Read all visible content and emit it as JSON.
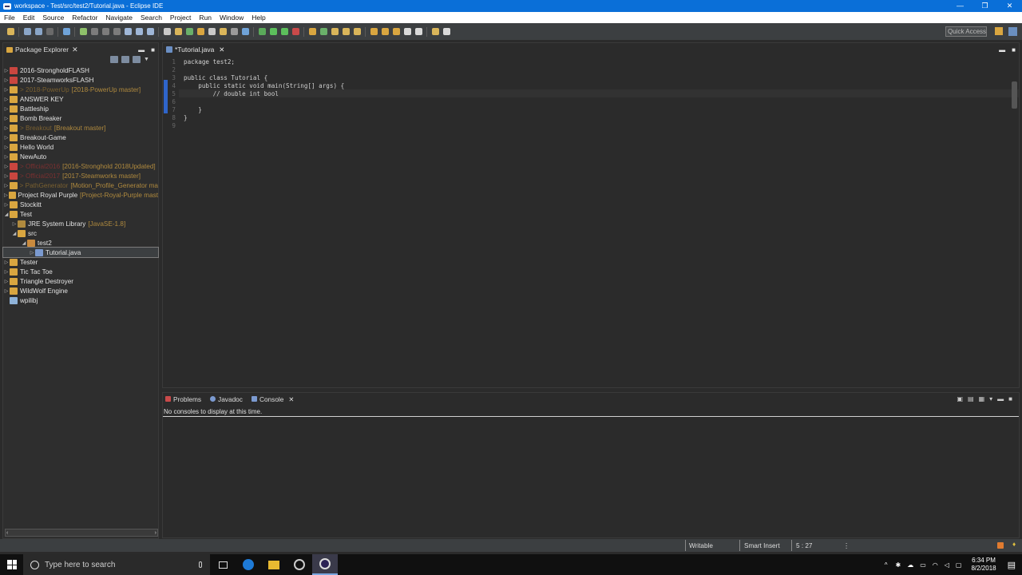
{
  "window": {
    "title": "workspace - Test/src/test2/Tutorial.java - Eclipse IDE",
    "minimize": "—",
    "maximize": "❐",
    "close": "✕"
  },
  "menu": [
    "File",
    "Edit",
    "Source",
    "Refactor",
    "Navigate",
    "Search",
    "Project",
    "Run",
    "Window",
    "Help"
  ],
  "toolbar": {
    "quick_access": "Quick Access"
  },
  "package_explorer": {
    "title": "Package Explorer",
    "items": [
      {
        "label": "2016-StrongholdFLASH",
        "deco": ""
      },
      {
        "label": "2017-SteamworksFLASH",
        "deco": ""
      },
      {
        "label": "> 2018-PowerUp",
        "deco": "[2018-PowerUp master]"
      },
      {
        "label": "ANSWER KEY",
        "deco": ""
      },
      {
        "label": "Battleship",
        "deco": ""
      },
      {
        "label": "Bomb Breaker",
        "deco": ""
      },
      {
        "label": "> Breakout",
        "deco": "[Breakout master]"
      },
      {
        "label": "Breakout-Game",
        "deco": ""
      },
      {
        "label": "Hello World",
        "deco": ""
      },
      {
        "label": "NewAuto",
        "deco": ""
      },
      {
        "label": "> Official2016",
        "deco": "[2016-Stronghold 2018Updated]"
      },
      {
        "label": "> Official2017",
        "deco": "[2017-Steamworks master]"
      },
      {
        "label": "> PathGenerator",
        "deco": "[Motion_Profile_Generator ma"
      },
      {
        "label": "Project Royal Purple",
        "deco": "[Project-Royal-Purple mast"
      },
      {
        "label": "Stockitt",
        "deco": ""
      },
      {
        "label": "Test",
        "deco": ""
      },
      {
        "label": "JRE System Library",
        "deco": "[JavaSE-1.8]"
      },
      {
        "label": "src",
        "deco": ""
      },
      {
        "label": "test2",
        "deco": ""
      },
      {
        "label": "Tutorial.java",
        "deco": ""
      },
      {
        "label": "Tester",
        "deco": ""
      },
      {
        "label": "Tic Tac Toe",
        "deco": ""
      },
      {
        "label": "Triangle Destroyer",
        "deco": ""
      },
      {
        "label": "WildWolf Engine",
        "deco": ""
      },
      {
        "label": "wpilibj",
        "deco": ""
      }
    ]
  },
  "editor": {
    "tab_label": "*Tutorial.java",
    "lines": [
      {
        "n": "1",
        "text": "package test2;"
      },
      {
        "n": "2",
        "text": ""
      },
      {
        "n": "3",
        "text": "public class Tutorial {"
      },
      {
        "n": "4",
        "text": "    public static void main(String[] args) {"
      },
      {
        "n": "5",
        "text": "        // double int bool"
      },
      {
        "n": "6",
        "text": ""
      },
      {
        "n": "7",
        "text": "    }"
      },
      {
        "n": "8",
        "text": "}"
      },
      {
        "n": "9",
        "text": ""
      }
    ]
  },
  "bottom_panel": {
    "tabs": [
      "Problems",
      "Javadoc",
      "Console"
    ],
    "message": "No consoles to display at this time."
  },
  "status_bar": {
    "writable": "Writable",
    "insert_mode": "Smart Insert",
    "position": "5 : 27"
  },
  "taskbar": {
    "search_placeholder": "Type here to search",
    "time": "6:34 PM",
    "date": "8/2/2018"
  }
}
